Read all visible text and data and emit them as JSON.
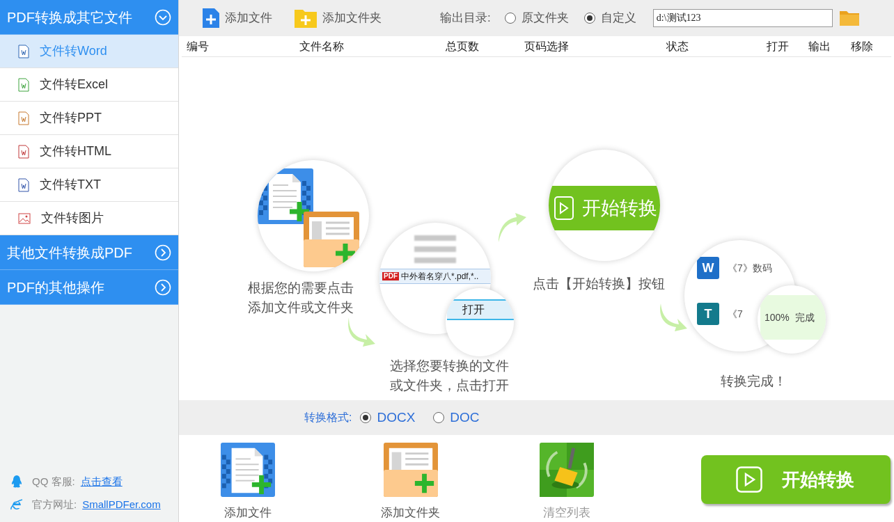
{
  "sidebar": {
    "groups": [
      {
        "label": "PDF转换成其它文件",
        "expanded": true,
        "items": [
          {
            "label": "文件转Word",
            "kind": "word",
            "selected": true
          },
          {
            "label": "文件转Excel",
            "kind": "excel",
            "selected": false
          },
          {
            "label": "文件转PPT",
            "kind": "ppt",
            "selected": false
          },
          {
            "label": "文件转HTML",
            "kind": "html",
            "selected": false
          },
          {
            "label": "文件转TXT",
            "kind": "txt",
            "selected": false
          },
          {
            "label": "文件转图片",
            "kind": "image",
            "selected": false
          }
        ]
      },
      {
        "label": "其他文件转换成PDF",
        "expanded": false
      },
      {
        "label": "PDF的其他操作",
        "expanded": false
      }
    ],
    "footer": [
      {
        "kind": "qq",
        "label": "QQ 客服:",
        "link": "点击查看"
      },
      {
        "kind": "web",
        "label": "官方网址:",
        "link": "SmallPDFer.com"
      }
    ]
  },
  "toolbar": {
    "buttons": [
      {
        "label": "添加文件",
        "kind": "file"
      },
      {
        "label": "添加文件夹",
        "kind": "folder"
      }
    ],
    "output_label": "输出目录:",
    "output_options": [
      {
        "label": "原文件夹",
        "selected": false
      },
      {
        "label": "自定义",
        "selected": true
      }
    ],
    "output_path": "d:\\测试123"
  },
  "table": {
    "columns": [
      "编号",
      "文件名称",
      "总页数",
      "页码选择",
      "状态",
      "打开",
      "输出",
      "移除"
    ]
  },
  "guide": {
    "captions": [
      "根据您的需要点击添加文件或文件夹",
      "选择您要转换的文件或文件夹，点击打开",
      "点击【开始转换】按钮",
      "转换完成！"
    ],
    "dialog_badge": "PDF",
    "dialog_file": "中外着名穿八*.pdf,*..",
    "dialog_button": "打开",
    "start_label": "开始转换",
    "result_rows": [
      {
        "badge": "W",
        "text": "《7》数码",
        "color": "#1e6fc8"
      },
      {
        "badge": "T",
        "text": "《7",
        "color": "#137a8c"
      }
    ],
    "result_status": "100%  完成"
  },
  "format": {
    "label": "转换格式:",
    "options": [
      {
        "label": "DOCX",
        "selected": true
      },
      {
        "label": "DOC",
        "selected": false
      }
    ]
  },
  "actions": [
    {
      "label": "添加文件",
      "kind": "file"
    },
    {
      "label": "添加文件夹",
      "kind": "folder"
    },
    {
      "label": "清空列表",
      "kind": "clear"
    }
  ],
  "start_button": "开始转换"
}
